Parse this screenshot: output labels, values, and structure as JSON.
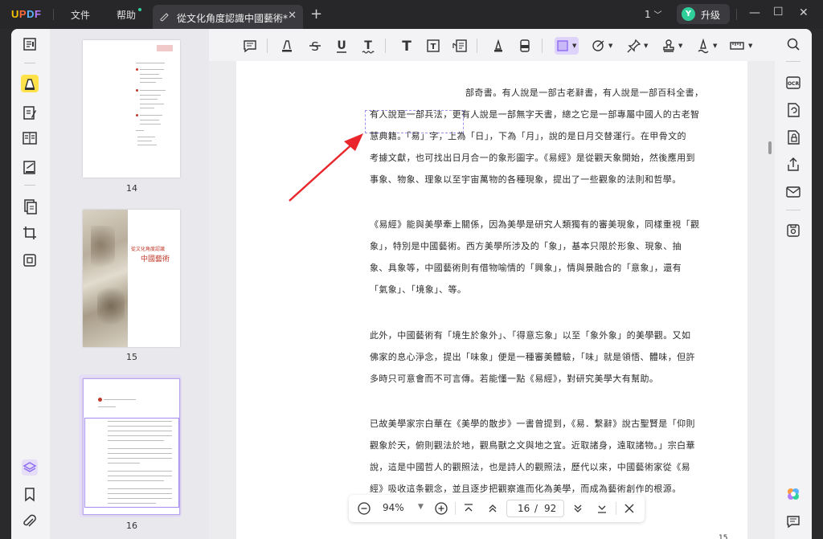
{
  "app": {
    "logo": "UPDF"
  },
  "menu": {
    "file": "文件",
    "help": "帮助"
  },
  "tab": {
    "title": "從文化角度認識中國藝術*"
  },
  "titlebar": {
    "page_indicator": "1",
    "upgrade": "升级",
    "avatar_letter": "Y"
  },
  "thumbnails": [
    {
      "page": "14"
    },
    {
      "page": "15",
      "cover_title_small": "從文化角度認識",
      "cover_title_big": "中國藝術"
    },
    {
      "page": "16"
    }
  ],
  "document": {
    "paragraphs": [
      [
        "部奇書。有人說是一部古老辭書，有人說是一部百科全書，",
        "有人說是一部兵法，更有人說是一部無字天書，總之它是一部專屬中國人的古老智",
        "慧典籍。「易」字，上為「日」，下為「月」，說的是日月交替運行。在甲骨文的",
        "考據文獻，也可找出日月合一的象形圖字。《易經》是從觀天象開始，然後應用到",
        "事象、物象、理象以至宇宙萬物的各種現象，提出了一些觀象的法則和哲學。"
      ],
      [
        "《易經》能與美學牽上關係，因為美學是研究人類獨有的審美現象，同樣重視「觀",
        "象」，特別是中國藝術。西方美學所涉及的「象」，基本只限於形象、現象、抽",
        "象、具象等，中國藝術則有借物喻情的「興象」，情與景融合的「意象」，還有",
        "「氣象」、「境象」、等。"
      ],
      [
        "此外，中國藝術有「境生於象外」、「得意忘象」以至「象外象」的美學觀。又如",
        "佛家的息心淨念，提出「味象」便是一種審美體驗，「味」就是領悟、體味，但許",
        "多時只可意會而不可言傳。若能懂一點《易經》，對研究美學大有幫助。"
      ],
      [
        "已故美學家宗白華在《美學的散步》一書曾提到，《易．繫辭》說古聖賢是「仰則",
        "觀象於天，俯則觀法於地，觀鳥獸之文與地之宜。近取諸身，遠取諸物。」宗白華",
        "說，這是中國哲人的觀照法，也是詩人的觀照法，歷代以來，中國藝術家從《易",
        "經》吸收這条觀念，並且逐步把觀察進而化為美學，而成為藝術創作的根源。"
      ]
    ],
    "footer_page": "15"
  },
  "zoom": {
    "value": "94%",
    "current_page": "16",
    "separator": "/",
    "total_pages": "92"
  },
  "colors": {
    "accent": "#8e6cf0",
    "highlight_yellow": "#ffe24a",
    "annotation_arrow": "#e8262b",
    "selected_thumb": "#e6def6"
  },
  "icons": {
    "toolbar": [
      "comment-icon",
      "highlight-icon",
      "strikethrough-icon",
      "underline-icon",
      "squiggly-icon",
      "text-icon",
      "textbox-icon",
      "text-callout-icon",
      "pencil-icon",
      "eraser-icon",
      "shape-icon",
      "arrow-shape-icon",
      "pin-icon",
      "stamp-icon",
      "signature-icon",
      "measure-icon"
    ],
    "left_rail": [
      "reader-icon",
      "comment-mode-icon",
      "edit-pdf-icon",
      "organize-pages-icon",
      "fill-sign-icon",
      "convert-icon",
      "crop-icon",
      "compress-icon",
      "layers-icon",
      "bookmark-icon",
      "attachment-icon"
    ],
    "right_rail": [
      "search-icon",
      "ocr-icon",
      "convert-pdf-icon",
      "protect-icon",
      "share-icon",
      "email-icon",
      "save-icon",
      "ai-assistant-icon",
      "chat-icon"
    ]
  }
}
